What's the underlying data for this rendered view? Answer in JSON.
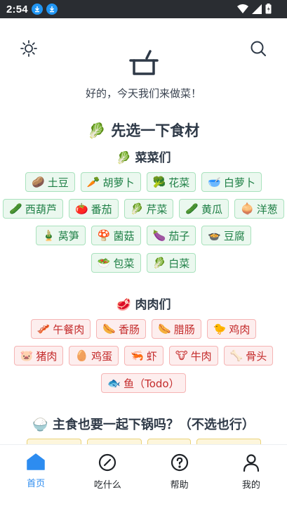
{
  "status_bar": {
    "time": "2:54"
  },
  "header": {
    "greeting": "好的，今天我们来做菜！"
  },
  "main": {
    "section_title": "🥬 先选一下食材",
    "vegetables": {
      "title": "🥬 菜菜们",
      "items": [
        {
          "emoji": "🥔",
          "label": "土豆"
        },
        {
          "emoji": "🥕",
          "label": "胡萝卜"
        },
        {
          "emoji": "🥦",
          "label": "花菜"
        },
        {
          "emoji": "🥣",
          "label": "白萝卜"
        },
        {
          "emoji": "🥒",
          "label": "西葫芦"
        },
        {
          "emoji": "🍅",
          "label": "番茄"
        },
        {
          "emoji": "🥬",
          "label": "芹菜"
        },
        {
          "emoji": "🥒",
          "label": "黄瓜"
        },
        {
          "emoji": "🧅",
          "label": "洋葱"
        },
        {
          "emoji": "🎍",
          "label": "莴笋"
        },
        {
          "emoji": "🍄",
          "label": "菌菇"
        },
        {
          "emoji": "🍆",
          "label": "茄子"
        },
        {
          "emoji": "🍲",
          "label": "豆腐"
        },
        {
          "emoji": "🥗",
          "label": "包菜"
        },
        {
          "emoji": "🥬",
          "label": "白菜"
        }
      ]
    },
    "meats": {
      "title": "🥩 肉肉们",
      "items": [
        {
          "emoji": "🥓",
          "label": "午餐肉"
        },
        {
          "emoji": "🌭",
          "label": "香肠"
        },
        {
          "emoji": "🌭",
          "label": "腊肠"
        },
        {
          "emoji": "🐤",
          "label": "鸡肉"
        },
        {
          "emoji": "🐷",
          "label": "猪肉"
        },
        {
          "emoji": "🥚",
          "label": "鸡蛋"
        },
        {
          "emoji": "🦐",
          "label": "虾"
        },
        {
          "emoji": "🐮",
          "label": "牛肉"
        },
        {
          "emoji": "🦴",
          "label": "骨头"
        },
        {
          "emoji": "🐟",
          "label": "鱼（Todo）"
        }
      ]
    },
    "staples": {
      "title": "🍚 主食也要一起下锅吗？（不选也行）"
    }
  },
  "tabbar": {
    "items": [
      {
        "label": "首页",
        "icon": "home-icon",
        "active": true
      },
      {
        "label": "吃什么",
        "icon": "compass-icon"
      },
      {
        "label": "帮助",
        "icon": "help-icon"
      },
      {
        "label": "我的",
        "icon": "user-icon"
      }
    ]
  },
  "colors": {
    "accent": "#2d8cf0",
    "veg_bg": "#ebf8ef",
    "veg_text": "#1e7f45",
    "meat_bg": "#fdeeee",
    "meat_text": "#c42b2b",
    "staple_bg": "#fdf6dc"
  }
}
